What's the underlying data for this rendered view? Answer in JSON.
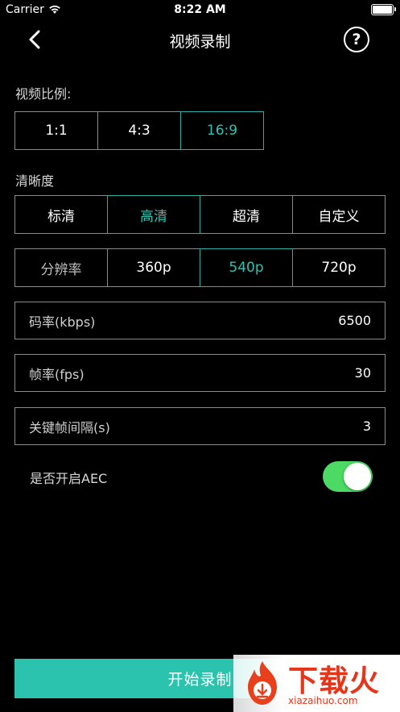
{
  "status_bar": {
    "carrier": "Carrier",
    "time": "8:22 AM"
  },
  "nav": {
    "title": "视频录制",
    "help": "?"
  },
  "aspect_ratio": {
    "label": "视频比例:",
    "options": [
      "1:1",
      "4:3",
      "16:9"
    ],
    "selected": "16:9"
  },
  "quality": {
    "label": "清晰度",
    "options": [
      "标清",
      "高清",
      "超清",
      "自定义"
    ],
    "selected": "高清"
  },
  "resolution": {
    "label": "分辨率",
    "options": [
      "360p",
      "540p",
      "720p"
    ],
    "selected": "540p"
  },
  "fields": {
    "bitrate": {
      "label": "码率(kbps)",
      "value": "6500"
    },
    "framerate": {
      "label": "帧率(fps)",
      "value": "30"
    },
    "keyframe": {
      "label": "关键帧间隔(s)",
      "value": "3"
    }
  },
  "aec": {
    "label": "是否开启AEC",
    "enabled": true
  },
  "start_button": {
    "label": "开始录制"
  },
  "watermark": {
    "cn": "下载火",
    "en": "xiazaihuo.com"
  },
  "colors": {
    "accent": "#2bc3ad",
    "toggle_on": "#4cd964",
    "border": "#8a8a8a"
  }
}
